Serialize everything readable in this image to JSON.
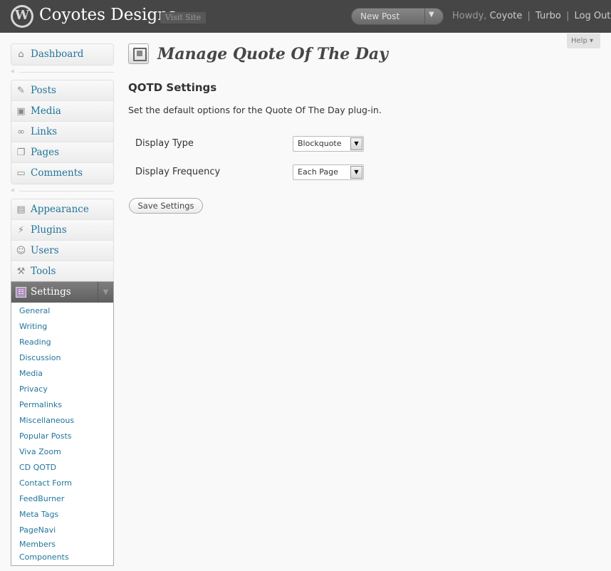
{
  "header": {
    "logo_glyph": "W",
    "site_title": "Coyotes Designs",
    "visit_site": "Visit Site",
    "favorite_action": "New Post",
    "howdy": "Howdy,",
    "username": "Coyote",
    "turbo": "Turbo",
    "logout": "Log Out",
    "separator": "|"
  },
  "help_tab": {
    "label": "Help"
  },
  "menu": {
    "collapse_glyph": "«",
    "dashboard": {
      "label": "Dashboard",
      "icon": "dashboard-icon"
    },
    "group1": [
      {
        "label": "Posts",
        "icon": "pin-icon"
      },
      {
        "label": "Media",
        "icon": "media-icon"
      },
      {
        "label": "Links",
        "icon": "link-icon"
      },
      {
        "label": "Pages",
        "icon": "pages-icon"
      },
      {
        "label": "Comments",
        "icon": "comment-icon"
      }
    ],
    "group2": [
      {
        "label": "Appearance",
        "icon": "appearance-icon"
      },
      {
        "label": "Plugins",
        "icon": "plugin-icon"
      },
      {
        "label": "Users",
        "icon": "users-icon"
      },
      {
        "label": "Tools",
        "icon": "tools-icon"
      }
    ],
    "settings": {
      "label": "Settings",
      "icon": "settings-icon",
      "submenu": [
        "General",
        "Writing",
        "Reading",
        "Discussion",
        "Media",
        "Privacy",
        "Permalinks",
        "Miscellaneous",
        "Popular Posts",
        "Viva Zoom",
        "CD QOTD",
        "Contact Form",
        "FeedBurner",
        "Meta Tags",
        "PageNavi"
      ],
      "last_item": {
        "line1": "Members",
        "line2": "Components"
      }
    }
  },
  "main": {
    "page_title": "Manage Quote Of The Day",
    "section_title": "QOTD Settings",
    "description": "Set the default options for the Quote Of The Day plug-in.",
    "fields": [
      {
        "label": "Display Type",
        "value": "Blockquote"
      },
      {
        "label": "Display Frequency",
        "value": "Each Page"
      }
    ],
    "save_button": "Save Settings"
  },
  "colors": {
    "header_bg": "#464646",
    "link": "#21759b",
    "page_bg": "#f9f9f9"
  }
}
